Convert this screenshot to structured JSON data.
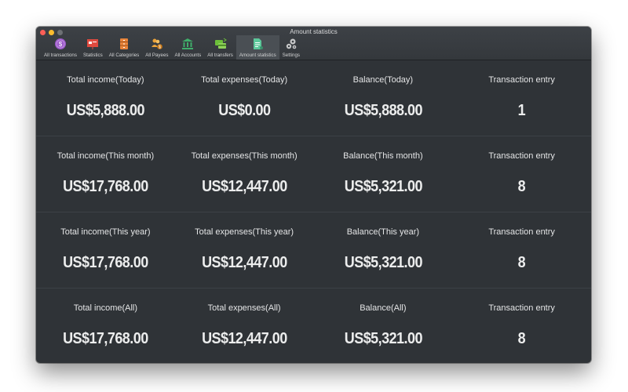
{
  "window": {
    "title": "Amount statistics"
  },
  "toolbar": {
    "items": [
      {
        "label": "All transactions",
        "icon": "dollar-circle-icon",
        "color": "#9b59c9",
        "active": false
      },
      {
        "label": "Statistics",
        "icon": "presentation-chart-icon",
        "color": "#e04a3f",
        "active": false
      },
      {
        "label": "All Categories",
        "icon": "drawer-cabinet-icon",
        "color": "#e8843a",
        "active": false
      },
      {
        "label": "All Payees",
        "icon": "people-coin-icon",
        "color": "#eba33a",
        "active": false
      },
      {
        "label": "All Accounts",
        "icon": "bank-icon",
        "color": "#3fae6a",
        "active": false
      },
      {
        "label": "All transfers",
        "icon": "card-transfer-icon",
        "color": "#6cbf3a",
        "active": false
      },
      {
        "label": "Amount statistics",
        "icon": "document-calc-icon",
        "color": "#5cc79a",
        "active": true
      },
      {
        "label": "Settings",
        "icon": "gears-icon",
        "color": "#c8c9ca",
        "active": false
      }
    ]
  },
  "stats": {
    "rows": [
      {
        "cells": [
          {
            "label": "Total income(Today)",
            "value": "US$5,888.00"
          },
          {
            "label": "Total expenses(Today)",
            "value": "US$0.00"
          },
          {
            "label": "Balance(Today)",
            "value": "US$5,888.00"
          },
          {
            "label": "Transaction entry",
            "value": "1"
          }
        ]
      },
      {
        "cells": [
          {
            "label": "Total income(This month)",
            "value": "US$17,768.00"
          },
          {
            "label": "Total expenses(This month)",
            "value": "US$12,447.00"
          },
          {
            "label": "Balance(This month)",
            "value": "US$5,321.00"
          },
          {
            "label": "Transaction entry",
            "value": "8"
          }
        ]
      },
      {
        "cells": [
          {
            "label": "Total income(This year)",
            "value": "US$17,768.00"
          },
          {
            "label": "Total expenses(This year)",
            "value": "US$12,447.00"
          },
          {
            "label": "Balance(This year)",
            "value": "US$5,321.00"
          },
          {
            "label": "Transaction entry",
            "value": "8"
          }
        ]
      },
      {
        "cells": [
          {
            "label": "Total income(All)",
            "value": "US$17,768.00"
          },
          {
            "label": "Total expenses(All)",
            "value": "US$12,447.00"
          },
          {
            "label": "Balance(All)",
            "value": "US$5,321.00"
          },
          {
            "label": "Transaction entry",
            "value": "8"
          }
        ]
      }
    ]
  }
}
